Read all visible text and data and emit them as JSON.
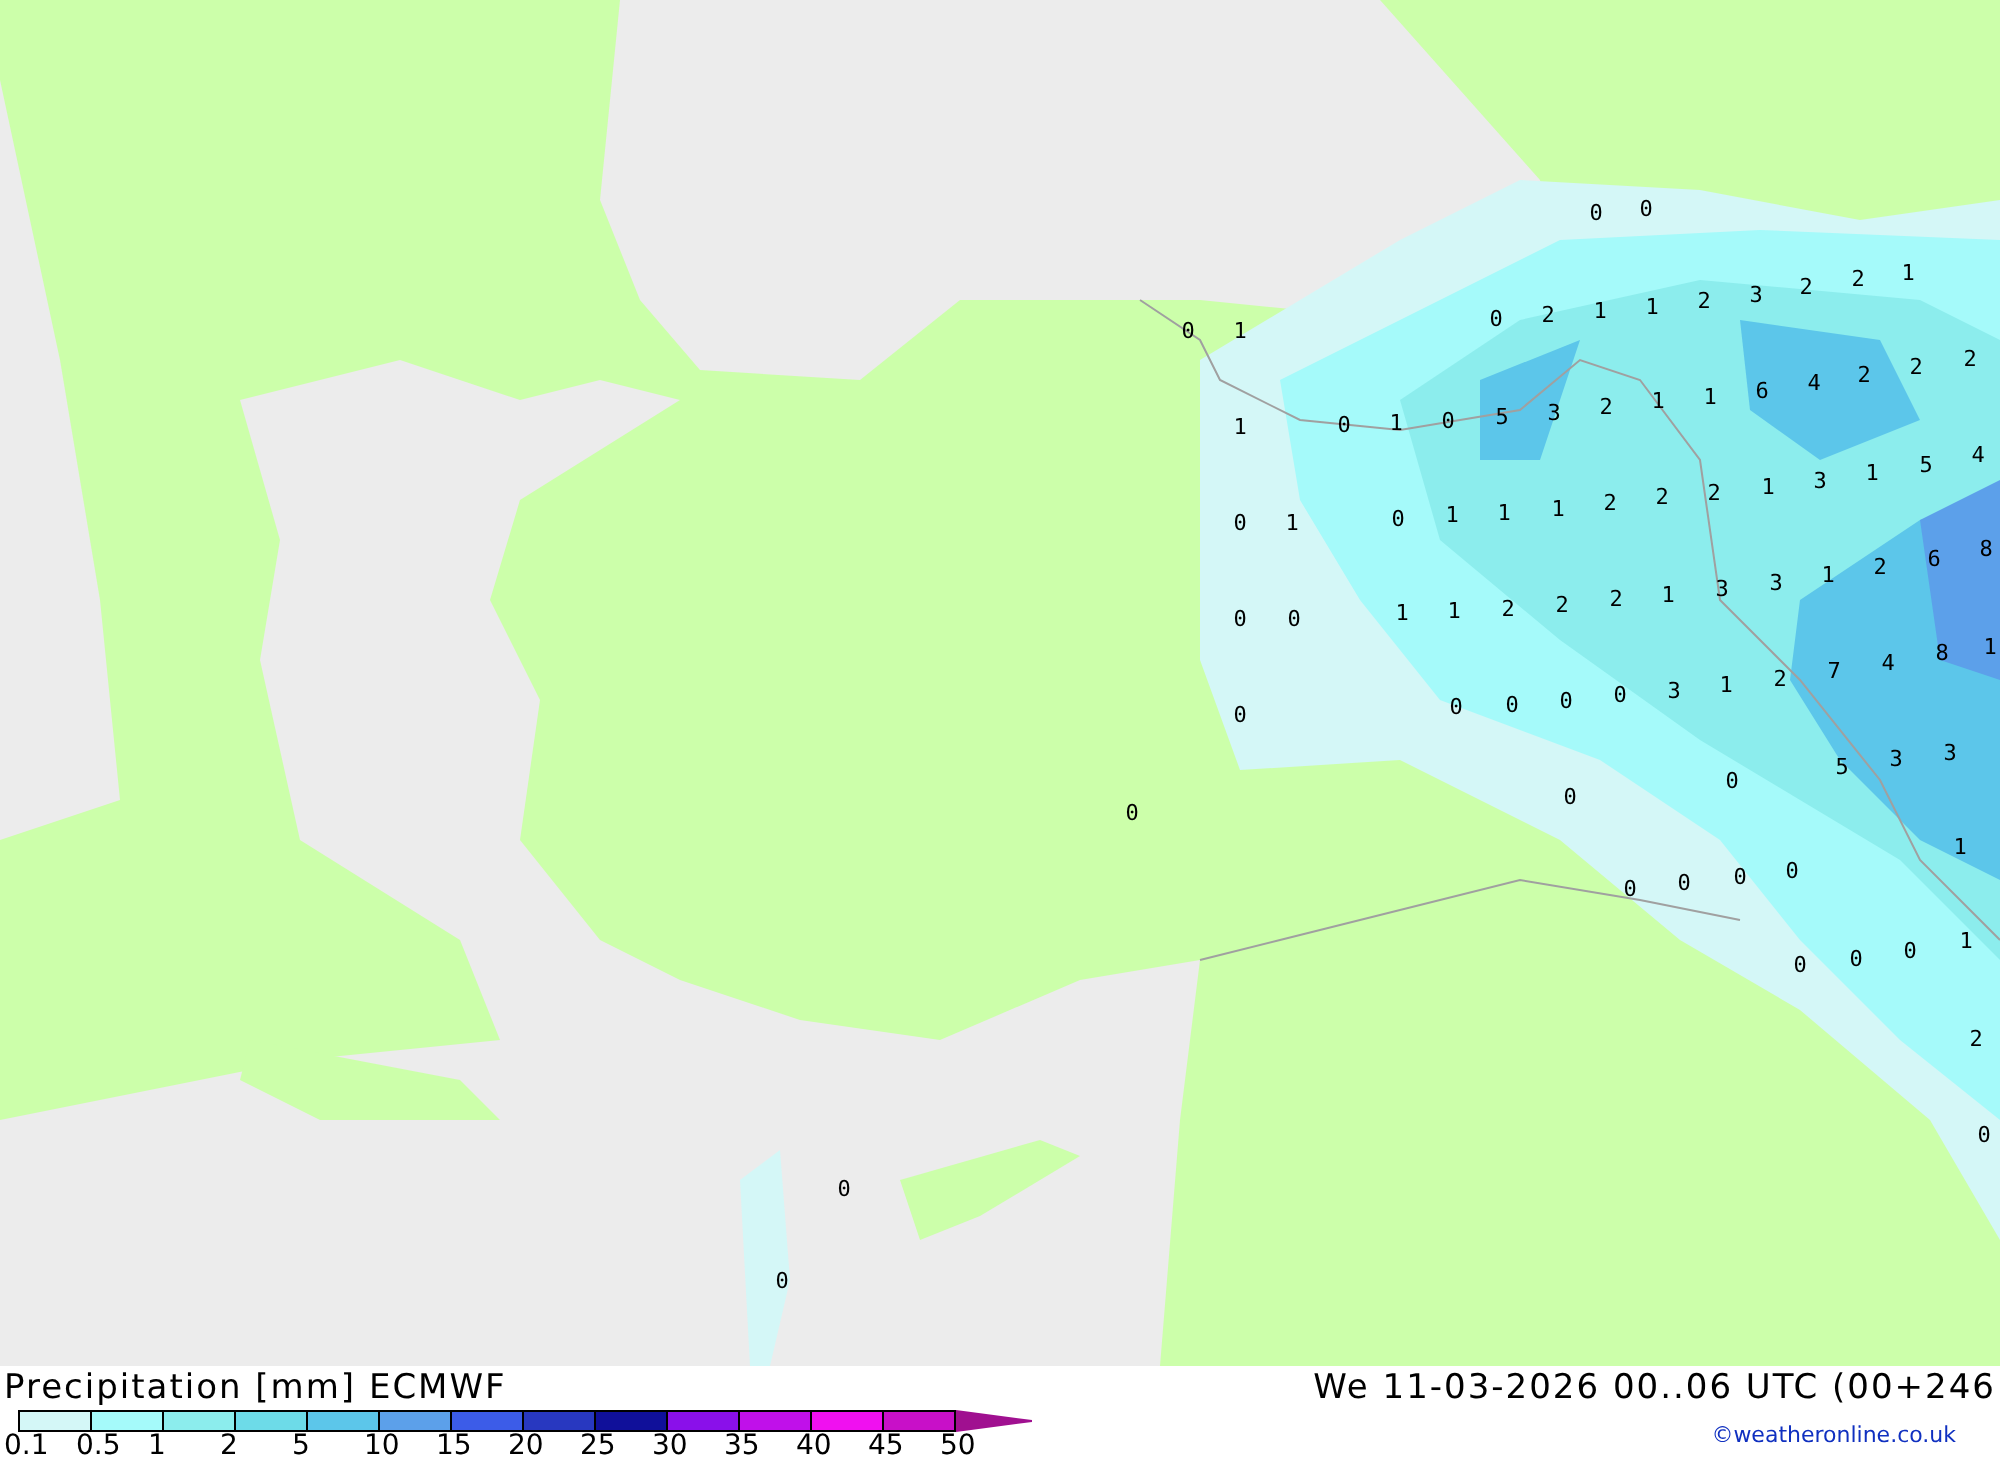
{
  "map": {
    "labels": [
      {
        "text": "0"
      },
      {
        "text": "0"
      },
      {
        "text": "0"
      },
      {
        "text": "2"
      },
      {
        "text": "1"
      },
      {
        "text": "1"
      },
      {
        "text": "2"
      },
      {
        "text": "3"
      },
      {
        "text": "2"
      },
      {
        "text": "2"
      },
      {
        "text": "1"
      },
      {
        "text": "0"
      },
      {
        "text": "1"
      },
      {
        "text": "1"
      },
      {
        "text": "0"
      },
      {
        "text": "1"
      },
      {
        "text": "0"
      },
      {
        "text": "5"
      },
      {
        "text": "3"
      },
      {
        "text": "2"
      },
      {
        "text": "1"
      },
      {
        "text": "1"
      },
      {
        "text": "6"
      },
      {
        "text": "4"
      },
      {
        "text": "2"
      },
      {
        "text": "2"
      },
      {
        "text": "2"
      },
      {
        "text": "0"
      },
      {
        "text": "1"
      },
      {
        "text": "0"
      },
      {
        "text": "1"
      },
      {
        "text": "1"
      },
      {
        "text": "1"
      },
      {
        "text": "2"
      },
      {
        "text": "2"
      },
      {
        "text": "2"
      },
      {
        "text": "1"
      },
      {
        "text": "3"
      },
      {
        "text": "1"
      },
      {
        "text": "5"
      },
      {
        "text": "4"
      },
      {
        "text": "0"
      },
      {
        "text": "0"
      },
      {
        "text": "1"
      },
      {
        "text": "1"
      },
      {
        "text": "2"
      },
      {
        "text": "2"
      },
      {
        "text": "2"
      },
      {
        "text": "1"
      },
      {
        "text": "3"
      },
      {
        "text": "3"
      },
      {
        "text": "1"
      },
      {
        "text": "2"
      },
      {
        "text": "6"
      },
      {
        "text": "8"
      },
      {
        "text": "0"
      },
      {
        "text": "0"
      },
      {
        "text": "0"
      },
      {
        "text": "0"
      },
      {
        "text": "0"
      },
      {
        "text": "3"
      },
      {
        "text": "1"
      },
      {
        "text": "2"
      },
      {
        "text": "7"
      },
      {
        "text": "4"
      },
      {
        "text": "8"
      },
      {
        "text": "1"
      },
      {
        "text": "5"
      },
      {
        "text": "3"
      },
      {
        "text": "3"
      },
      {
        "text": "0"
      },
      {
        "text": "0"
      },
      {
        "text": "0"
      },
      {
        "text": "1"
      },
      {
        "text": "0"
      },
      {
        "text": "0"
      },
      {
        "text": "0"
      },
      {
        "text": "0"
      },
      {
        "text": "0"
      },
      {
        "text": "0"
      },
      {
        "text": "0"
      },
      {
        "text": "1"
      },
      {
        "text": "2"
      },
      {
        "text": "0"
      },
      {
        "text": "0"
      },
      {
        "text": "0"
      }
    ]
  },
  "footer": {
    "title": "Precipitation [mm] ECMWF",
    "datetime": "We 11-03-2026 00..06 UTC (00+246",
    "credit": "©weatheronline.co.uk",
    "legend": [
      {
        "kind": "box",
        "label": "0.1",
        "color": "#d4f7f7"
      },
      {
        "kind": "box",
        "label": "0.5",
        "color": "#a5fafa"
      },
      {
        "kind": "box",
        "label": "1",
        "color": "#8ceded"
      },
      {
        "kind": "box",
        "label": "2",
        "color": "#6ddbe8"
      },
      {
        "kind": "box",
        "label": "5",
        "color": "#5cc6ea"
      },
      {
        "kind": "box",
        "label": "10",
        "color": "#5ca0ea"
      },
      {
        "kind": "box",
        "label": "15",
        "color": "#3c5ce8"
      },
      {
        "kind": "box",
        "label": "20",
        "color": "#2838c0"
      },
      {
        "kind": "box",
        "label": "25",
        "color": "#10109a"
      },
      {
        "kind": "box",
        "label": "30",
        "color": "#8a10ea"
      },
      {
        "kind": "box",
        "label": "35",
        "color": "#c010ea"
      },
      {
        "kind": "box",
        "label": "40",
        "color": "#f010f0"
      },
      {
        "kind": "box",
        "label": "45",
        "color": "#c810c8"
      },
      {
        "kind": "arrow",
        "label": "50",
        "color": "#a01090"
      }
    ]
  }
}
